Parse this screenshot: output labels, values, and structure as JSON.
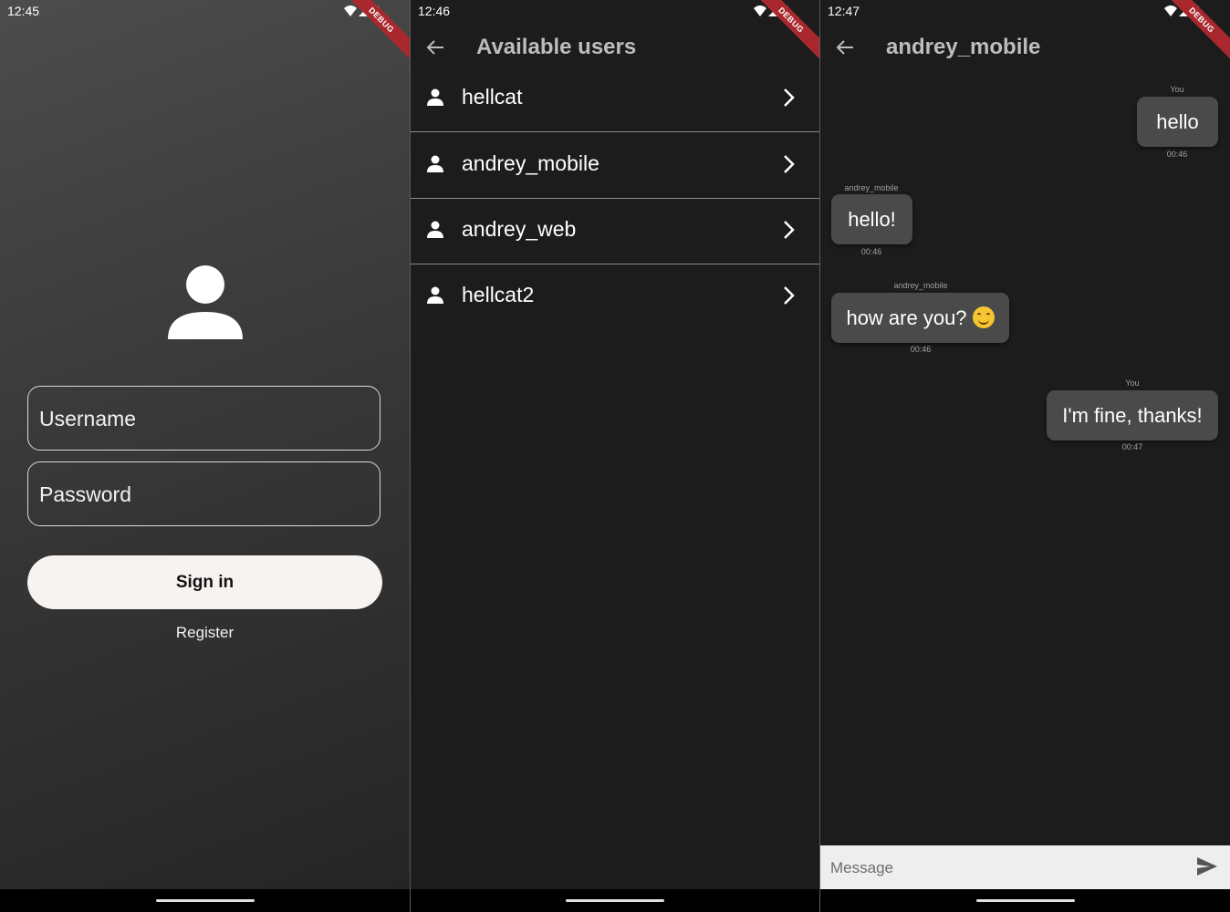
{
  "login": {
    "status_time": "12:45",
    "debug_banner": "DEBUG",
    "avatar_icon": "person-icon",
    "username_placeholder": "Username",
    "password_placeholder": "Password",
    "sign_in_label": "Sign in",
    "register_label": "Register"
  },
  "users": {
    "status_time": "12:46",
    "debug_banner": "DEBUG",
    "title": "Available users",
    "items": [
      {
        "name": "hellcat"
      },
      {
        "name": "andrey_mobile"
      },
      {
        "name": "andrey_web"
      },
      {
        "name": "hellcat2"
      }
    ]
  },
  "chat": {
    "status_time": "12:47",
    "debug_banner": "DEBUG",
    "title": "andrey_mobile",
    "messages": [
      {
        "sender": "You",
        "text": "hello",
        "time": "00:46"
      },
      {
        "sender": "andrey_mobile",
        "text": "hello!",
        "time": "00:46"
      },
      {
        "sender": "andrey_mobile",
        "text": "how are you?",
        "emoji": "smiling-face",
        "time": "00:46"
      },
      {
        "sender": "You",
        "text": "I'm fine, thanks!",
        "time": "00:47"
      }
    ],
    "input_placeholder": "Message"
  },
  "colors": {
    "background": "#1c1c1c",
    "bubble": "#4a4a4a",
    "debug_banner": "#a8282e",
    "button": "#f6f3f1"
  }
}
